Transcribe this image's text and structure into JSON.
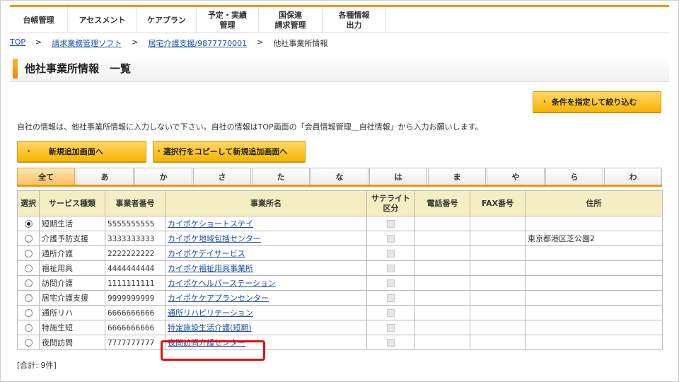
{
  "nav": {
    "items": [
      {
        "label": "台帳管理"
      },
      {
        "label": "アセスメント"
      },
      {
        "label": "ケアプラン"
      },
      {
        "label": "予定・実績\n管理"
      },
      {
        "label": "国保連\n請求管理"
      },
      {
        "label": "各種情報\n出力"
      }
    ]
  },
  "breadcrumb": {
    "top": "TOP",
    "sep": ">",
    "item1": "請求業務管理ソフト",
    "item2": "居宅介護支援/9877770001",
    "current": "他社事業所情報"
  },
  "page": {
    "title": "他社事業所情報　一覧"
  },
  "buttons": {
    "filter": "条件を指定して絞り込む",
    "new": "新規追加画面へ",
    "copy": "選択行をコピーして新規追加画面へ",
    "arrow": "›"
  },
  "notice": "自社の情報は、他社事業所情報に入力しないで下さい。自社の情報はTOP画面の「会員情報管理＿自社情報」から入力お願いします。",
  "tabs": [
    "全て",
    "あ",
    "か",
    "さ",
    "た",
    "な",
    "は",
    "ま",
    "や",
    "ら",
    "わ"
  ],
  "table": {
    "headers": [
      "選択",
      "サービス種類",
      "事業者番号",
      "事業所名",
      "サテライト\n区分",
      "電話番号",
      "FAX番号",
      "住所"
    ],
    "rows": [
      {
        "selected": true,
        "service": "短期生活",
        "number": "5555555555",
        "name": "カイポケショートステイ",
        "phone": "",
        "fax": "",
        "address": ""
      },
      {
        "selected": false,
        "service": "介護予防支援",
        "number": "3333333333",
        "name": "カイポケ地域包括センター",
        "phone": "",
        "fax": "",
        "address": "東京都港区芝公園2"
      },
      {
        "selected": false,
        "service": "通所介護",
        "number": "2222222222",
        "name": "カイポケデイサービス",
        "phone": "",
        "fax": "",
        "address": ""
      },
      {
        "selected": false,
        "service": "福祉用具",
        "number": "4444444444",
        "name": "カイポケ福祉用具事業所",
        "phone": "",
        "fax": "",
        "address": ""
      },
      {
        "selected": false,
        "service": "訪問介護",
        "number": "1111111111",
        "name": "カイポケヘルパーステーション",
        "phone": "",
        "fax": "",
        "address": ""
      },
      {
        "selected": false,
        "service": "居宅介護支援",
        "number": "9999999999",
        "name": "カイポケケアプランセンター",
        "phone": "",
        "fax": "",
        "address": ""
      },
      {
        "selected": false,
        "service": "通所リハ",
        "number": "6666666666",
        "name": "通所リハビリテーション",
        "phone": "",
        "fax": "",
        "address": ""
      },
      {
        "selected": false,
        "service": "特施生短",
        "number": "6666666666",
        "name": "特定施設生活介護(短期)",
        "phone": "",
        "fax": "",
        "address": ""
      },
      {
        "selected": false,
        "service": "夜間訪問",
        "number": "7777777777",
        "name": "夜間訪問介護センター",
        "phone": "",
        "fax": "",
        "address": ""
      }
    ]
  },
  "total": "[合計: 9件]",
  "colors": {
    "accent": "#f39800",
    "button": "#f7b500",
    "header": "#f6eec3",
    "link": "#1a4fa3",
    "highlight": "#e01010"
  }
}
